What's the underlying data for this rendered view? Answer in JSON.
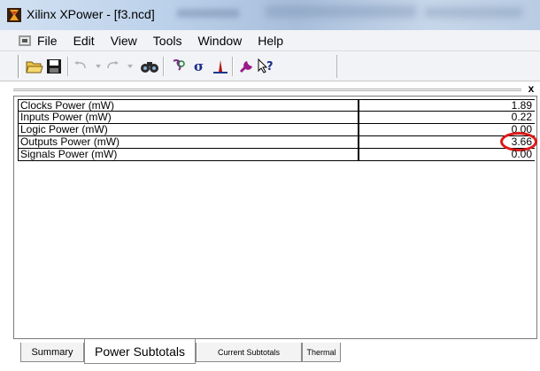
{
  "window": {
    "title": "Xilinx XPower - [f3.ncd]",
    "app_icon": "xilinx-logo-icon"
  },
  "menu": {
    "items": [
      {
        "label": "File"
      },
      {
        "label": "Edit"
      },
      {
        "label": "View"
      },
      {
        "label": "Tools"
      },
      {
        "label": "Window"
      },
      {
        "label": "Help"
      }
    ]
  },
  "toolbar": {
    "buttons": [
      {
        "name": "open-folder-icon"
      },
      {
        "name": "save-icon"
      },
      {
        "name": "undo-icon"
      },
      {
        "name": "redo-icon"
      },
      {
        "name": "find-icon"
      },
      {
        "name": "settings-icon"
      },
      {
        "name": "sigma-icon"
      },
      {
        "name": "chart-icon"
      },
      {
        "name": "tools-icon"
      },
      {
        "name": "help-pointer-icon"
      }
    ]
  },
  "panel": {
    "close_label": "x",
    "rows": [
      {
        "label": "Clocks Power (mW)",
        "value": "1.89"
      },
      {
        "label": "Inputs Power (mW)",
        "value": "0.22"
      },
      {
        "label": "Logic Power (mW)",
        "value": "0.00"
      },
      {
        "label": "Outputs Power (mW)",
        "value": "3.66",
        "highlighted": true
      },
      {
        "label": "Signals Power (mW)",
        "value": "0.00"
      }
    ]
  },
  "tabs": [
    {
      "label": "Summary",
      "active": false
    },
    {
      "label": "Power Subtotals",
      "active": true
    },
    {
      "label": "Current Subtotals",
      "active": false
    },
    {
      "label": "Thermal",
      "active": false
    }
  ],
  "colors": {
    "highlight": "#e01818",
    "menubar_bg": "#f1f3f6"
  }
}
